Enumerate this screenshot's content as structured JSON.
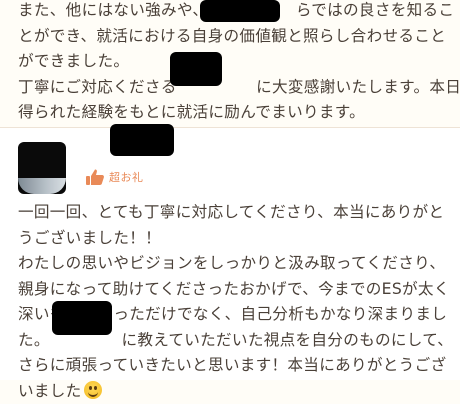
{
  "previous_review": {
    "lines": [
      "また、他にはない強みや、　　　　　　らではの良さを知るこ",
      "とができ、就活における自身の価値観と照らし合わせること",
      "ができました。",
      "丁寧にご対応くださる　　　　　に大変感謝いたします。本日、",
      "得られた経験をもとに就活に励んでまいります。"
    ]
  },
  "reply": {
    "badge_label": "超お礼",
    "badge_icon": "thumbs-up-icon",
    "lines": [
      "一回一回、とても丁寧に対応してくださり、本当にありがと",
      "うございました！！",
      "わたしの思いやビジョンをしっかりと汲み取ってくださり、",
      "親身になって助けてくださったおかげで、今までのESが太く",
      "深いものになっただけでなく、自己分析もかなり深まりまし",
      "た。　　　　　に教えていただいた視点を自分のものにして、",
      "さらに頑張っていきたいと思います！本当にありがとうござ",
      "いました"
    ],
    "emoji": "smiling-face-icon",
    "accent_color": "#e98a58"
  }
}
